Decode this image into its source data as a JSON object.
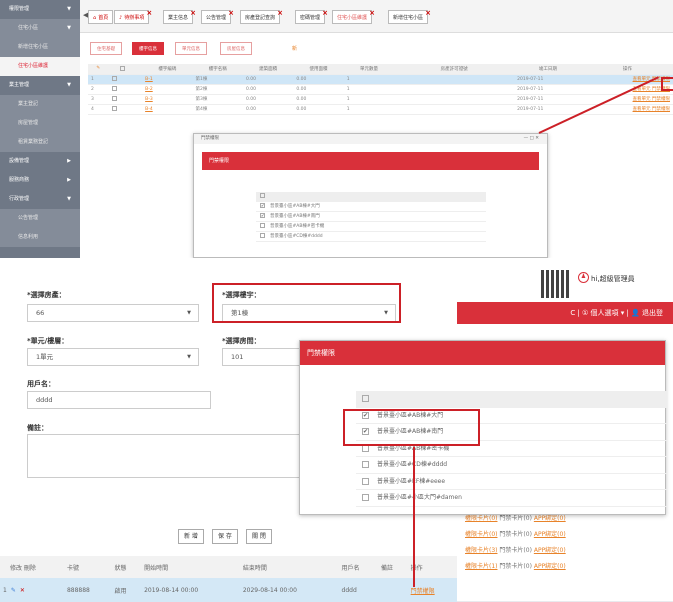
{
  "sidebar": {
    "items": [
      {
        "label": "權限管理",
        "kind": "top",
        "arrow": "▼"
      },
      {
        "label": "住宅小區",
        "kind": "sub",
        "arrow": "▼"
      },
      {
        "label": "新增住宅小區",
        "kind": "sub"
      },
      {
        "label": "住宅小區維護",
        "kind": "active"
      },
      {
        "label": "業主管理",
        "kind": "top",
        "arrow": "▼"
      },
      {
        "label": "業主登記",
        "kind": "sub"
      },
      {
        "label": "房屋管理",
        "kind": "sub"
      },
      {
        "label": "租賃業務登記",
        "kind": "sub"
      },
      {
        "label": "設備管理",
        "kind": "top",
        "arrow": "▶"
      },
      {
        "label": "服務商務",
        "kind": "top",
        "arrow": "▶"
      },
      {
        "label": "行政管理",
        "kind": "top",
        "arrow": "▼"
      },
      {
        "label": "公告管理",
        "kind": "sub"
      },
      {
        "label": "信息利用",
        "kind": "sub"
      }
    ]
  },
  "toptabs": [
    {
      "label": "首頁",
      "icon": "home-icon"
    },
    {
      "label": "待辦事項",
      "icon": "bell-icon"
    },
    {
      "label": "業主信息"
    },
    {
      "label": "公告管理"
    },
    {
      "label": "房產登記查詢"
    },
    {
      "label": "密碼管理"
    },
    {
      "label": "住宅小區維護",
      "active": true
    },
    {
      "label": "新增住宅小區"
    }
  ],
  "subtabs": [
    "住宅基礎",
    "樓宇信息",
    "單元信息",
    "房屋信息"
  ],
  "add_icon_label": "新",
  "table1": {
    "headers": [
      "",
      "",
      "樓宇編碼",
      "樓宇名稱",
      "建築面積",
      "使用面積",
      "單元數量",
      "房產許可證號",
      "竣工日期",
      "操作"
    ],
    "rows": [
      {
        "no": "1",
        "code": "B-1",
        "name": "第1棟",
        "area": "0.00",
        "use": "0.00",
        "units": "1",
        "date": "2019-07-11",
        "ops": "查看單元 門禁權限"
      },
      {
        "no": "2",
        "code": "B-2",
        "name": "第2棟",
        "area": "0.00",
        "use": "0.00",
        "units": "1",
        "date": "2019-07-11",
        "ops": "查看單元 門禁權限"
      },
      {
        "no": "3",
        "code": "B-3",
        "name": "第3棟",
        "area": "0.00",
        "use": "0.00",
        "units": "1",
        "date": "2019-07-11",
        "ops": "查看單元 門禁權限"
      },
      {
        "no": "4",
        "code": "B-4",
        "name": "第4棟",
        "area": "0.00",
        "use": "0.00",
        "units": "1",
        "date": "2019-07-11",
        "ops": "查看單元 門禁權限"
      }
    ]
  },
  "modal1": {
    "bar_title": "門禁權限",
    "controls": "—  □  ✕",
    "title": "門禁權限",
    "items": [
      {
        "label": "",
        "checked": false,
        "hd": true
      },
      {
        "label": "普景臺小區#AB棟#大門",
        "checked": true
      },
      {
        "label": "普景臺小區#AB棟#南門",
        "checked": true
      },
      {
        "label": "普景臺小區#AB棟#密卡機",
        "checked": false
      },
      {
        "label": "普景臺小區#CD棟#dddd",
        "checked": false
      }
    ]
  },
  "form": {
    "room_label": "*選擇房產：",
    "room_value": "66",
    "building_label": "*選擇樓宇：",
    "building_value": "第1棟",
    "unit_label": "*單元/樓層：",
    "unit_value": "1單元",
    "roomno_label": "*選擇房間：",
    "roomno_value": "101",
    "user_label": "用戶名：",
    "user_value": "dddd",
    "note_label": "備註："
  },
  "buttons": {
    "add": "新 增",
    "save": "保 存",
    "close": "關 閉"
  },
  "header2": {
    "admin": "hi,超級管理員",
    "nav": "C | ① 個人選項 ▾ | 👤 退出登"
  },
  "modal2": {
    "title": "門禁權限",
    "items": [
      {
        "label": "",
        "checked": false,
        "hd": true
      },
      {
        "label": "普景臺小區#AB棟#大門",
        "checked": true
      },
      {
        "label": "普景臺小區#AB棟#南門",
        "checked": true
      },
      {
        "label": "普景臺小區#AB棟#密卡機",
        "checked": false
      },
      {
        "label": "普景臺小區#CD棟#dddd",
        "checked": false
      },
      {
        "label": "普景臺小區#EF棟#eeee",
        "checked": false
      },
      {
        "label": "普景臺小區#小區大門#damen",
        "checked": false
      }
    ]
  },
  "rrows": [
    {
      "a": "權限卡片(0)",
      "b": "門禁卡片(0)",
      "c": "APP綁定(0)"
    },
    {
      "a": "權限卡片(0)",
      "b": "門禁卡片(0)",
      "c": "APP綁定(0)"
    },
    {
      "a": "權限卡片(3)",
      "b": "門禁卡片(0)",
      "c": "APP綁定(0)"
    },
    {
      "a": "權限卡片(1)",
      "b": "門禁卡片(0)",
      "c": "APP綁定(0)"
    }
  ],
  "table2": {
    "headers": [
      "修改 刪除",
      "卡號",
      "狀態",
      "開始時間",
      "結束時間",
      "用戶名",
      "備註",
      "操作"
    ],
    "row": {
      "no": "1",
      "card": "888888",
      "status": "啟用",
      "start": "2019-08-14 00:00",
      "end": "2029-08-14 00:00",
      "user": "dddd",
      "note": "",
      "op": "門禁權限"
    }
  },
  "colors": {
    "accent": "#d9303a",
    "highlight": "#cc2027",
    "link": "#e8832a",
    "sidebar": "#6f7886"
  }
}
